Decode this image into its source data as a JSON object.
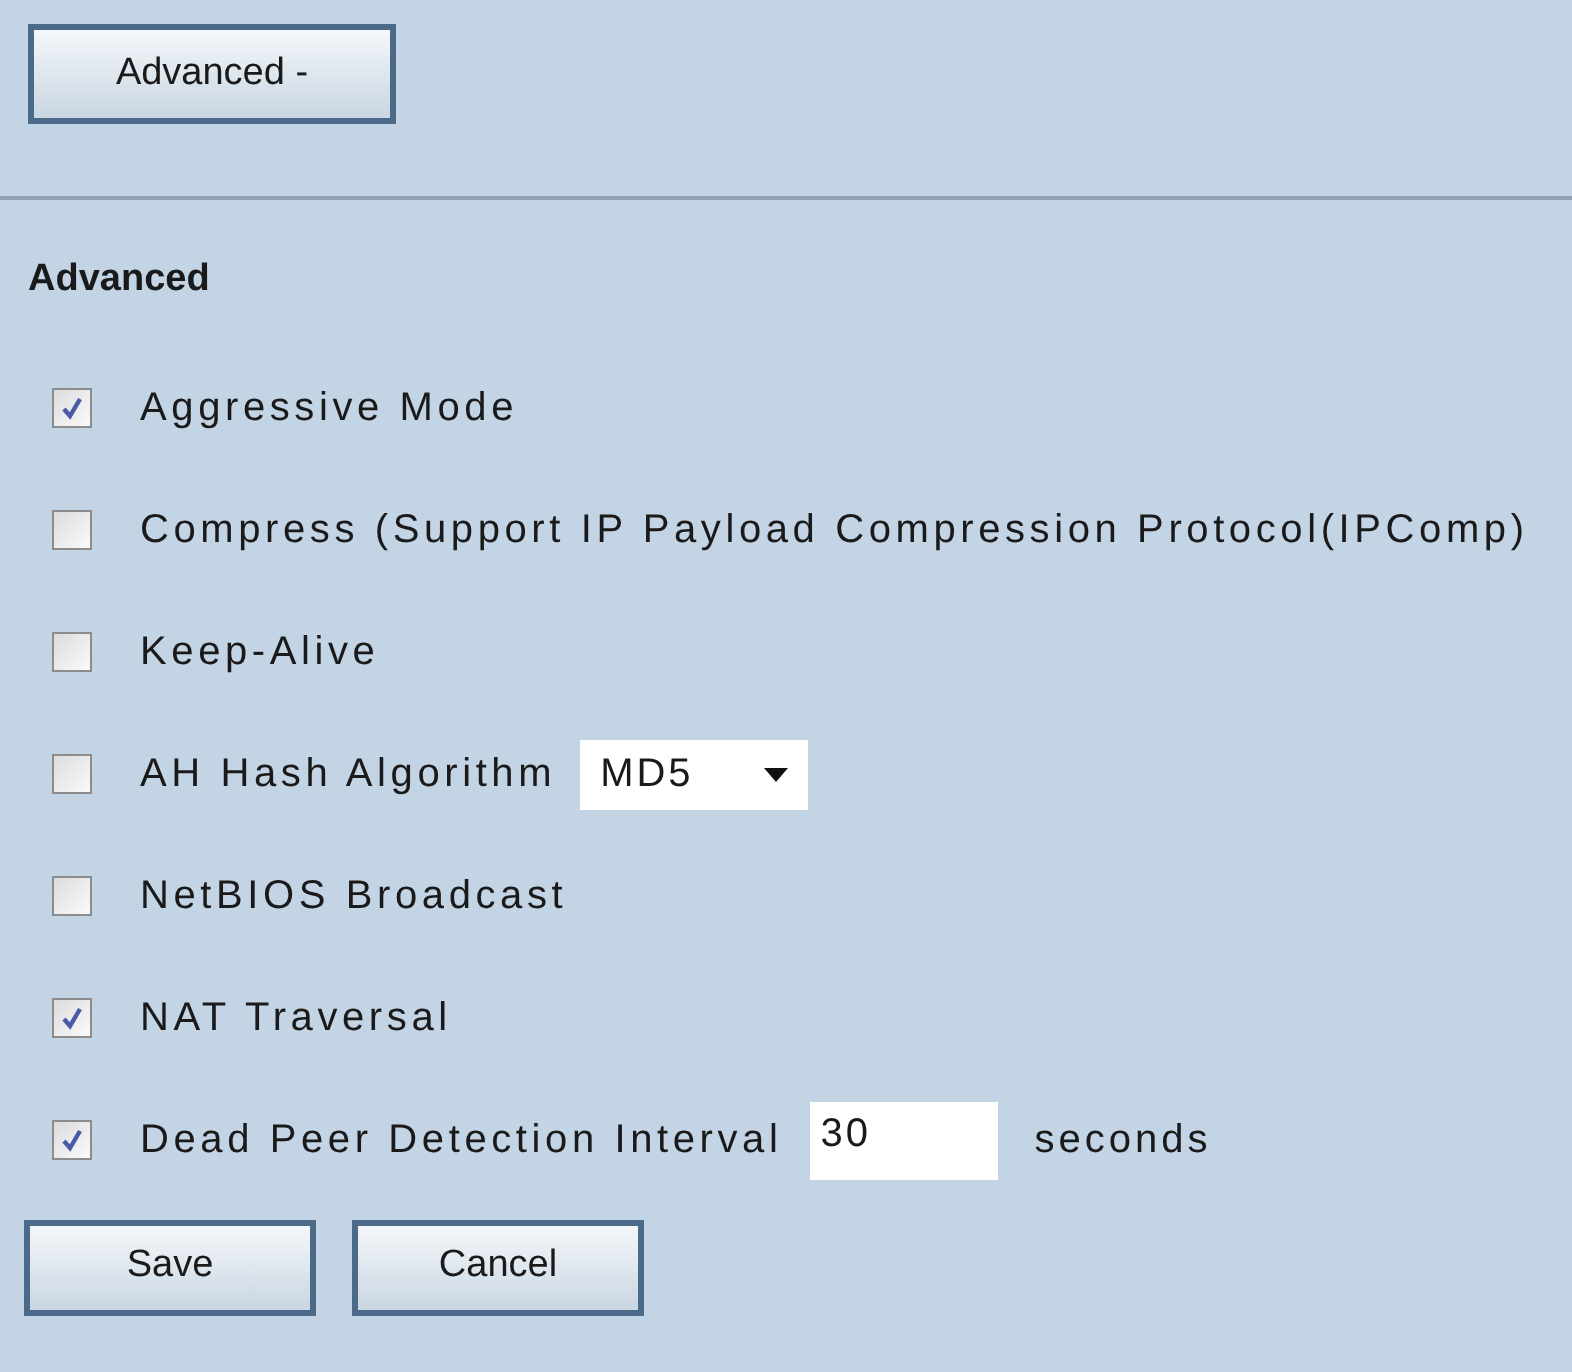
{
  "toggle_button": {
    "label": "Advanced -"
  },
  "section_title": "Advanced",
  "options": [
    {
      "kind": "plain",
      "label": "Aggressive Mode",
      "checked": true
    },
    {
      "kind": "plain",
      "label": "Compress (Support IP Payload Compression Protocol(IPComp)",
      "checked": false
    },
    {
      "kind": "plain",
      "label": "Keep-Alive",
      "checked": false
    },
    {
      "kind": "select",
      "label": "AH Hash Algorithm",
      "checked": false,
      "value": "MD5"
    },
    {
      "kind": "plain",
      "label": "NetBIOS Broadcast",
      "checked": false
    },
    {
      "kind": "plain",
      "label": "NAT Traversal",
      "checked": true
    },
    {
      "kind": "input",
      "label": "Dead Peer Detection Interval",
      "checked": true,
      "value": "30",
      "suffix": "seconds"
    }
  ],
  "buttons": [
    {
      "label": "Save"
    },
    {
      "label": "Cancel"
    }
  ]
}
